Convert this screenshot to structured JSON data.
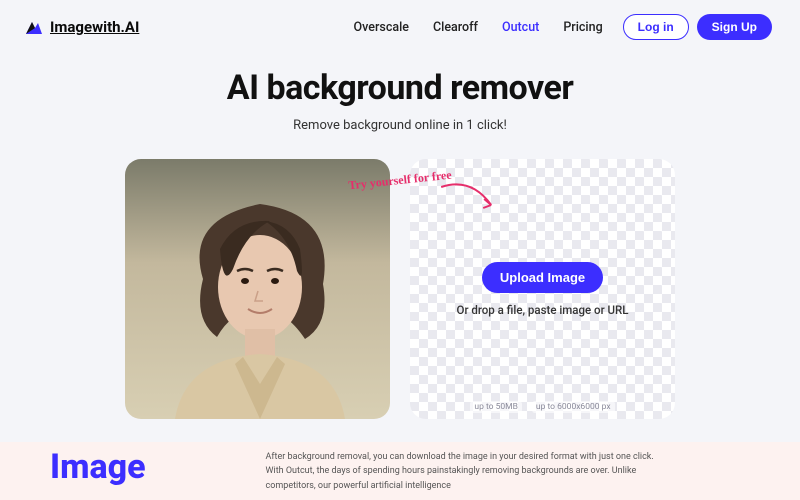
{
  "brand": {
    "name": "Imagewith.AI"
  },
  "nav": {
    "items": [
      {
        "label": "Overscale",
        "active": false
      },
      {
        "label": "Clearoff",
        "active": false
      },
      {
        "label": "Outcut",
        "active": true
      },
      {
        "label": "Pricing",
        "active": false
      }
    ]
  },
  "auth": {
    "login": "Log in",
    "signup": "Sign Up"
  },
  "hero": {
    "title": "AI background remover",
    "subtitle": "Remove background online in 1 click!"
  },
  "callout": {
    "text": "Try yourself for free"
  },
  "upload": {
    "button": "Upload Image",
    "drop_text": "Or drop a file, paste image or URL",
    "limits": {
      "size": "up to 50MB",
      "resolution": "up to 6000x6000 px"
    }
  },
  "bottom": {
    "heading": "Image",
    "para1": "After background removal, you can download the image in your desired format with just one click.",
    "para2": "With Outcut, the days of spending hours painstakingly removing backgrounds are over. Unlike competitors, our powerful artificial intelligence"
  },
  "colors": {
    "accent": "#3C2EFF",
    "callout": "#e62e6b"
  }
}
